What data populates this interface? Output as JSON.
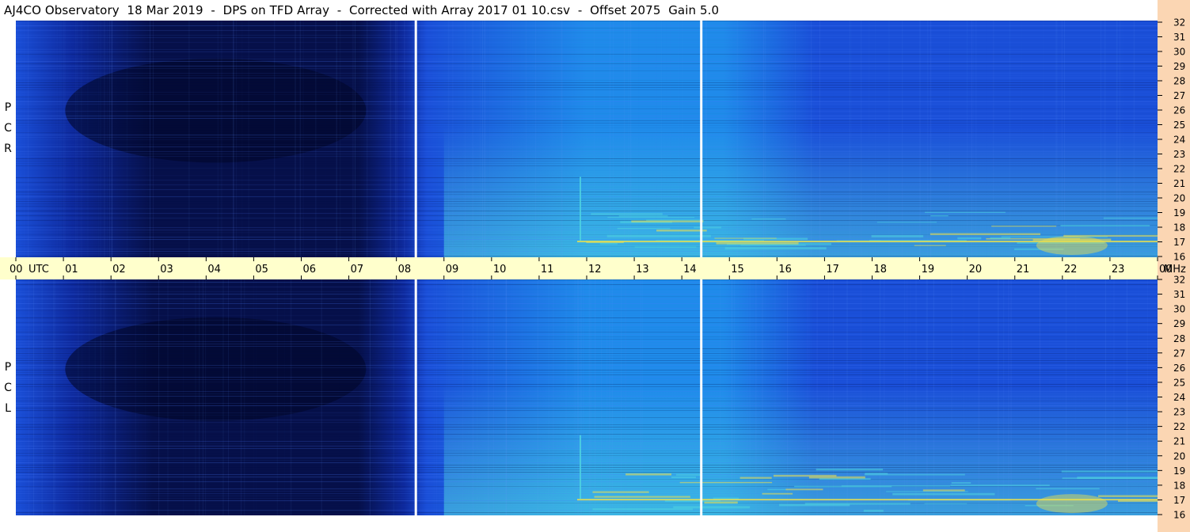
{
  "title": "AJ4CO Observatory  18 Mar 2019  -  DPS on TFD Array  -  Corrected with Array 2017 01 10.csv  -  Offset 2075  Gain 5.0",
  "panels": [
    {
      "name": "rcp",
      "label_letters": [
        "P",
        "C",
        "R"
      ]
    },
    {
      "name": "lcp",
      "label_letters": [
        "P",
        "C",
        "L"
      ]
    }
  ],
  "chart_data": {
    "type": "heatmap",
    "title": "AJ4CO Observatory  18 Mar 2019  -  DPS on TFD Array  -  Corrected with Array 2017 01 10.csv  -  Offset 2075  Gain 5.0",
    "x_ticks": [
      "00",
      "01",
      "02",
      "03",
      "04",
      "05",
      "06",
      "07",
      "08",
      "09",
      "10",
      "11",
      "12",
      "13",
      "14",
      "15",
      "16",
      "17",
      "18",
      "19",
      "20",
      "21",
      "22",
      "23",
      "00"
    ],
    "x_unit_label": "UTC",
    "xlim": [
      0,
      24
    ],
    "y_ticks": [
      "32",
      "31",
      "30",
      "29",
      "28",
      "27",
      "26",
      "25",
      "24",
      "23",
      "22",
      "21",
      "20",
      "19",
      "18",
      "17",
      "16"
    ],
    "y_unit_label": "MHz",
    "ylim": [
      16,
      32
    ],
    "series": [
      {
        "name": "R C P"
      },
      {
        "name": "L C P"
      }
    ],
    "data_gaps_utc": [
      8.4,
      14.4
    ],
    "colors": {
      "night": "#06104a",
      "dark": "#0e2a9e",
      "mid": "#1a4fd8",
      "day": "#1f8bea",
      "bright": "#4fd3e0",
      "hot": "#f0e24a"
    }
  }
}
